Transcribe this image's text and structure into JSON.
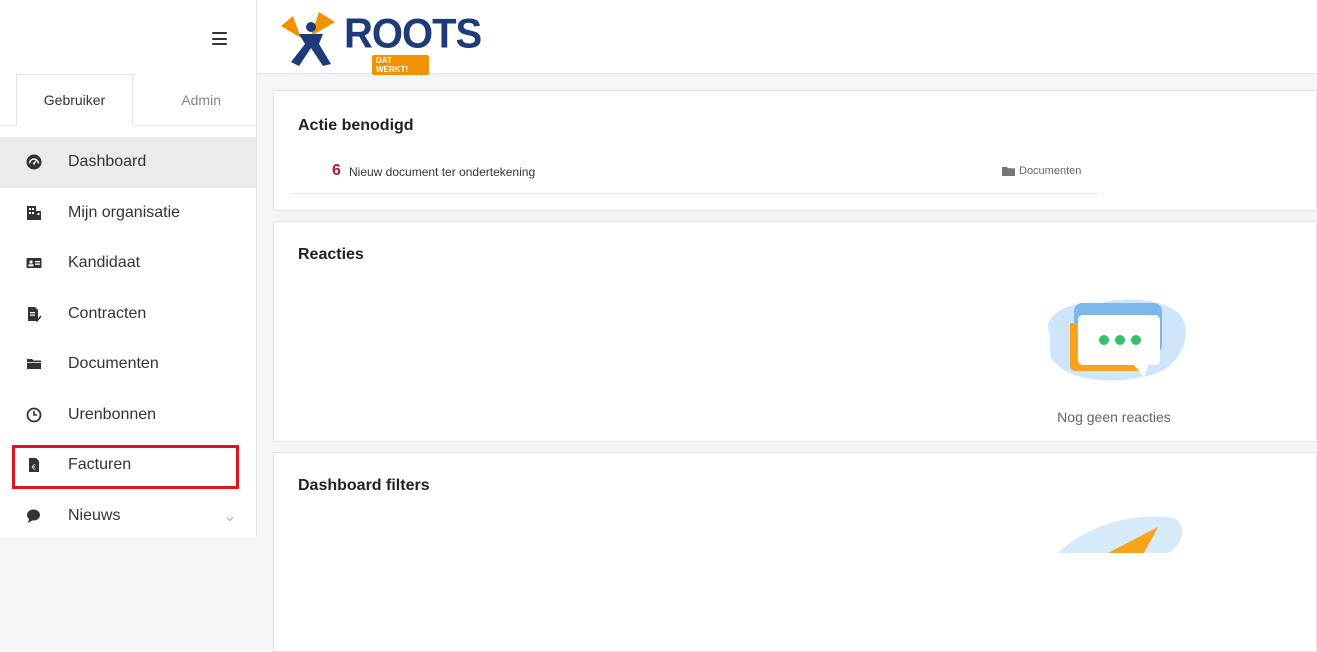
{
  "app": {
    "logo_text": "ROOTS",
    "logo_tagline": "DAT WERKT!"
  },
  "sidebar": {
    "tabs": [
      {
        "label": "Gebruiker",
        "active": true
      },
      {
        "label": "Admin",
        "active": false
      }
    ],
    "items": [
      {
        "label": "Dashboard",
        "icon": "dashboard-icon",
        "active": true
      },
      {
        "label": "Mijn organisatie",
        "icon": "building-icon"
      },
      {
        "label": "Kandidaat",
        "icon": "id-card-icon"
      },
      {
        "label": "Contracten",
        "icon": "contract-icon"
      },
      {
        "label": "Documenten",
        "icon": "folder-icon"
      },
      {
        "label": "Urenbonnen",
        "icon": "clock-icon"
      },
      {
        "label": "Facturen",
        "icon": "invoice-icon",
        "highlighted": true
      },
      {
        "label": "Nieuws",
        "icon": "news-icon",
        "has_submenu": true
      }
    ]
  },
  "main": {
    "action": {
      "title": "Actie benodigd",
      "rows": [
        {
          "count": "6",
          "text": "Nieuw document ter ondertekening",
          "link": "Documenten"
        }
      ]
    },
    "reacties": {
      "title": "Reacties",
      "empty_text": "Nog geen reacties"
    },
    "filters": {
      "title": "Dashboard filters"
    }
  },
  "colors": {
    "accent_red": "#b01c2e",
    "highlight": "#e0141e",
    "brand_blue": "#1f3a7a",
    "brand_orange": "#f39200"
  }
}
